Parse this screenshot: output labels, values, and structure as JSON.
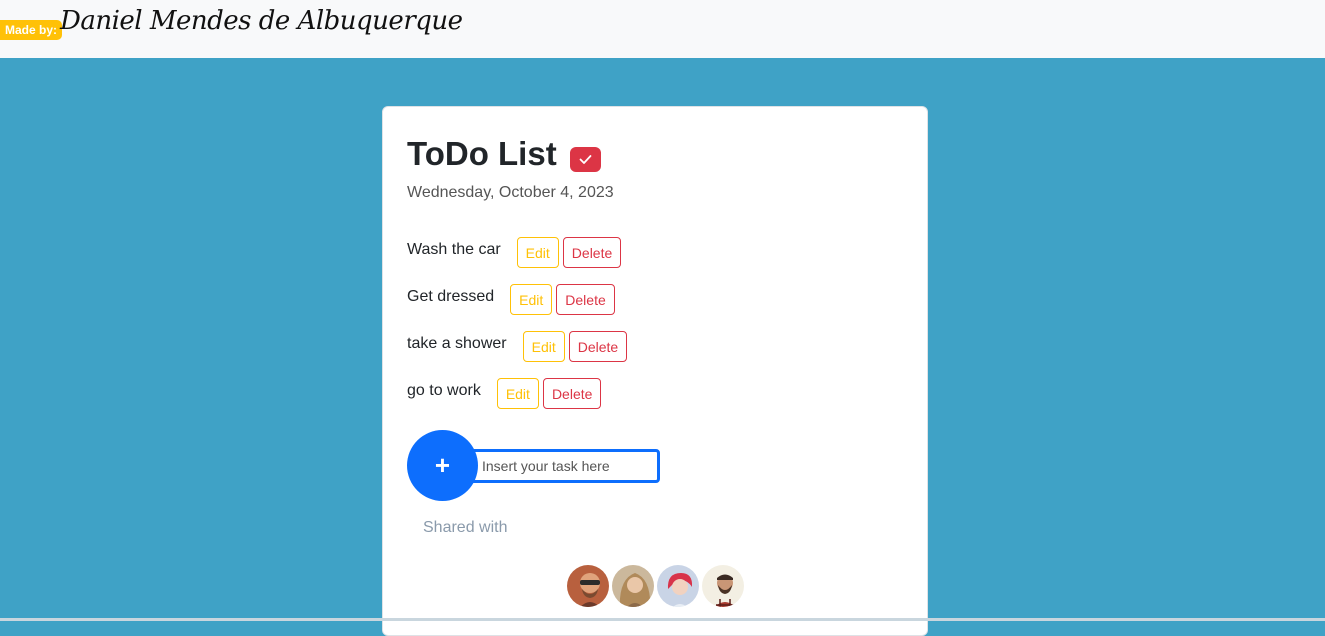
{
  "header": {
    "badge": "Made by:",
    "author": "Daniel Mendes de Albuquerque"
  },
  "card": {
    "title": "ToDo List",
    "title_icon": "check-icon",
    "date": "Wednesday, October 4, 2023",
    "tasks": [
      {
        "label": "Wash the car",
        "edit": "Edit",
        "delete": "Delete"
      },
      {
        "label": "Get dressed",
        "edit": "Edit",
        "delete": "Delete"
      },
      {
        "label": "take a shower",
        "edit": "Edit",
        "delete": "Delete"
      },
      {
        "label": "go to work",
        "edit": "Edit",
        "delete": "Delete"
      }
    ],
    "add_button": "+",
    "input_placeholder": "Insert your task here",
    "shared_label": "Shared with"
  },
  "colors": {
    "background": "#3fa2c6",
    "primary": "#0d6efd",
    "warning": "#ffc107",
    "danger": "#dc3545"
  }
}
